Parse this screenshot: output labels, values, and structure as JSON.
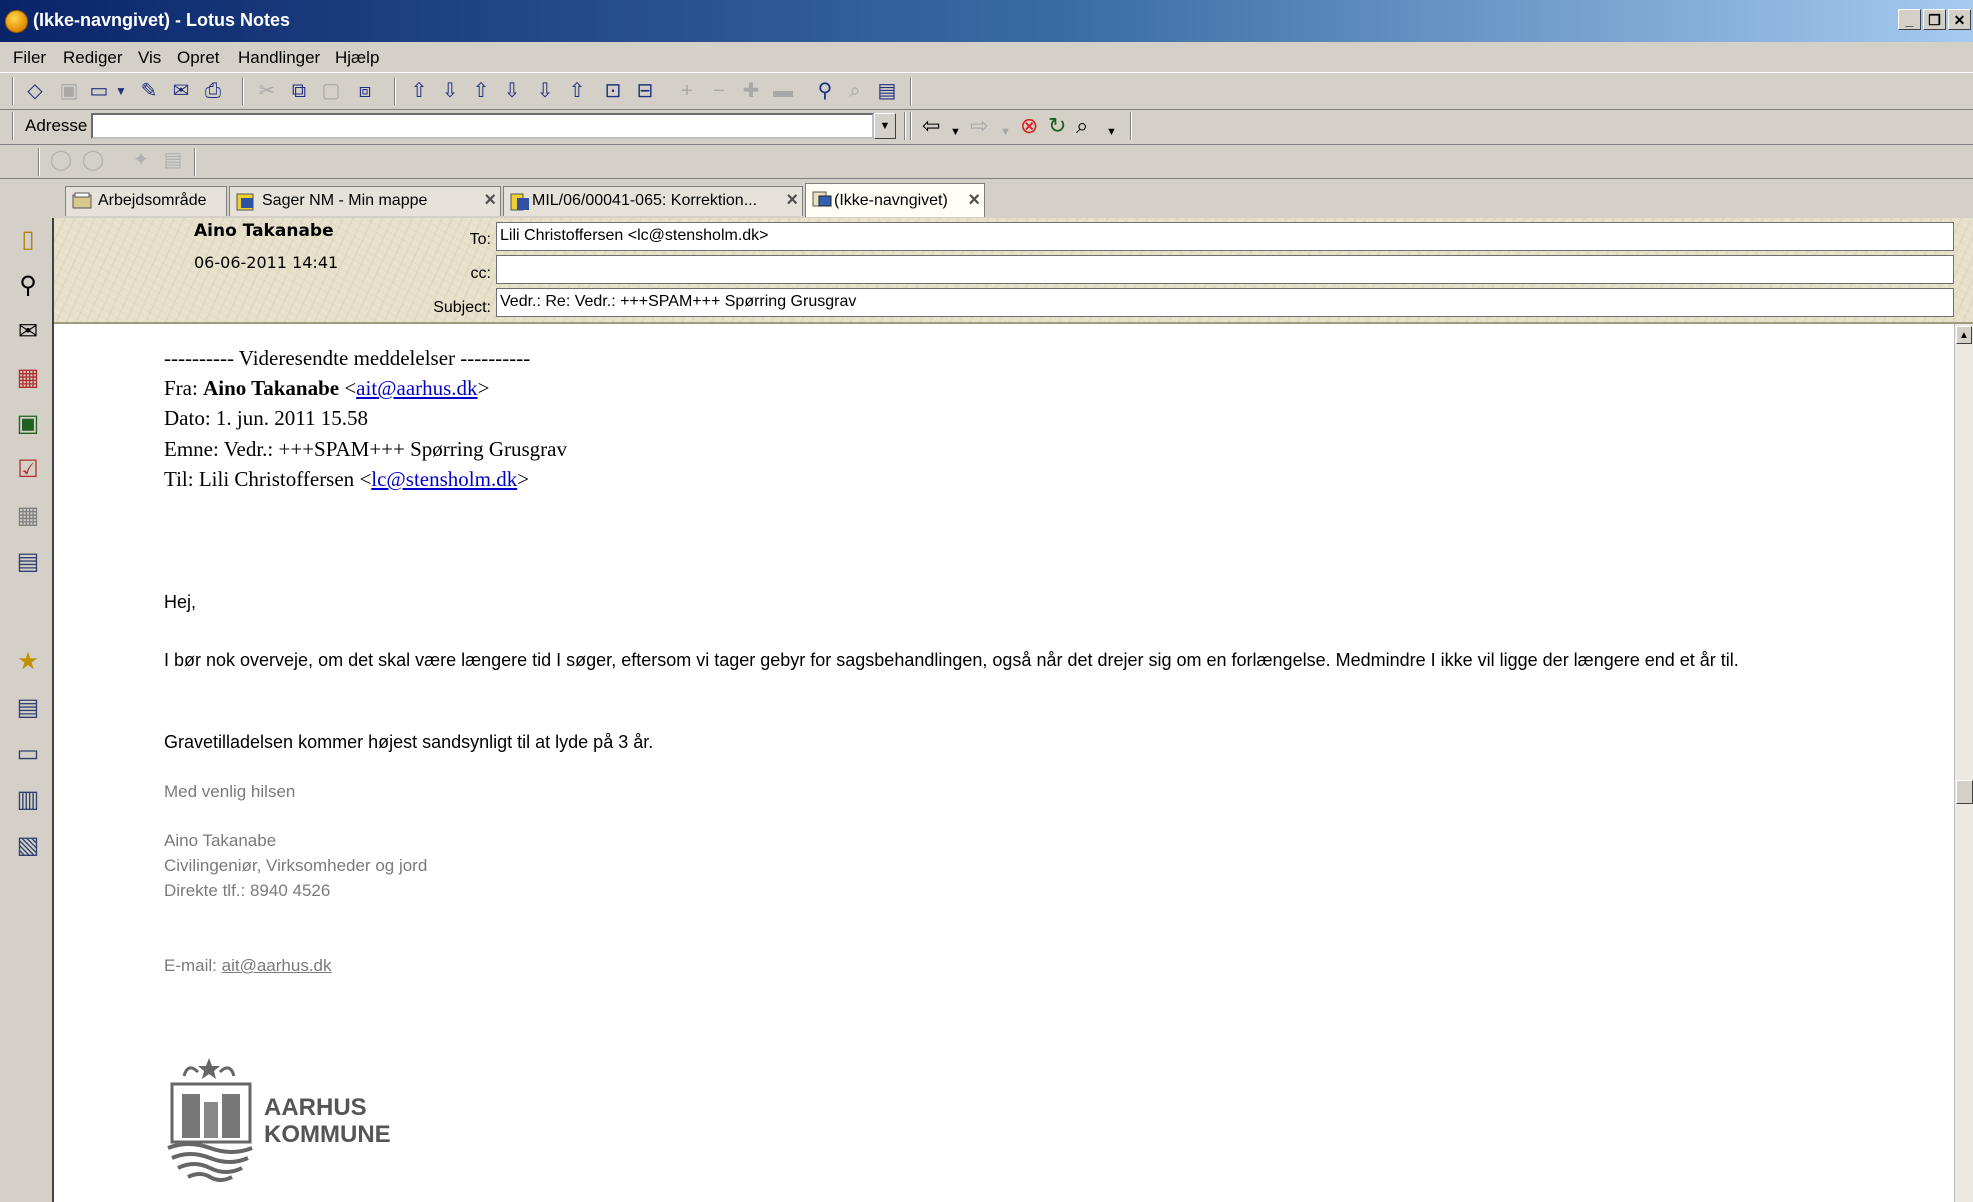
{
  "window": {
    "title": "(Ikke-navngivet) - Lotus Notes",
    "buttons": [
      "_",
      "❐",
      "✕"
    ]
  },
  "menu": [
    "Filer",
    "Rediger",
    "Vis",
    "Opret",
    "Handlinger",
    "Hjælp"
  ],
  "address_bar": {
    "label": "Adresse",
    "value": ""
  },
  "tabs": [
    {
      "label": "Arbejdsområde",
      "icon": "workspace-icon"
    },
    {
      "label": "Sager NM - Min mappe",
      "icon": "mail-folder-icon"
    },
    {
      "label": "MIL/06/00041-065: Korrektion...",
      "icon": "document-icon"
    },
    {
      "label": "(Ikke-navngivet)",
      "icon": "memo-icon"
    }
  ],
  "memo": {
    "from": "Aino Takanabe",
    "date": "06-06-2011 14:41",
    "to_label": "To:",
    "to": "Lili Christoffersen <lc@stensholm.dk>",
    "cc_label": "cc:",
    "cc": "",
    "subject_label": "Subject:",
    "subject": "Vedr.: Re: Vedr.: +++SPAM+++ Spørring Grusgrav"
  },
  "forwarded": {
    "heading": "---------- Videresendte meddelelser ----------",
    "from_label": "Fra:",
    "from_name": "Aino Takanabe",
    "from_email": "ait@aarhus.dk",
    "date_line": "Dato: 1. jun. 2011 15.58",
    "subject_line": "Emne: Vedr.: +++SPAM+++ Spørring Grusgrav",
    "to_label": "Til: Lili Christoffersen",
    "to_email": "lc@stensholm.dk"
  },
  "message": {
    "greeting": "Hej,",
    "paragraph1": "I bør nok overveje, om det skal være længere tid I søger, eftersom vi tager gebyr for sagsbehandlingen, også når det drejer sig om en forlængelse. Medmindre I ikke vil ligge der længere end et år til.",
    "paragraph2": "Gravetilladelsen kommer højest sandsynligt til at lyde på 3 år.",
    "closing": "Med venlig hilsen",
    "sig_name": "Aino Takanabe",
    "sig_title": "Civilingeniør, Virksomheder og jord",
    "sig_phone": "Direkte tlf.: 8940 4526",
    "email_label": "E-mail:",
    "email": "ait@aarhus.dk"
  },
  "logo": {
    "line1": "AARHUS",
    "line2": "KOMMUNE"
  }
}
